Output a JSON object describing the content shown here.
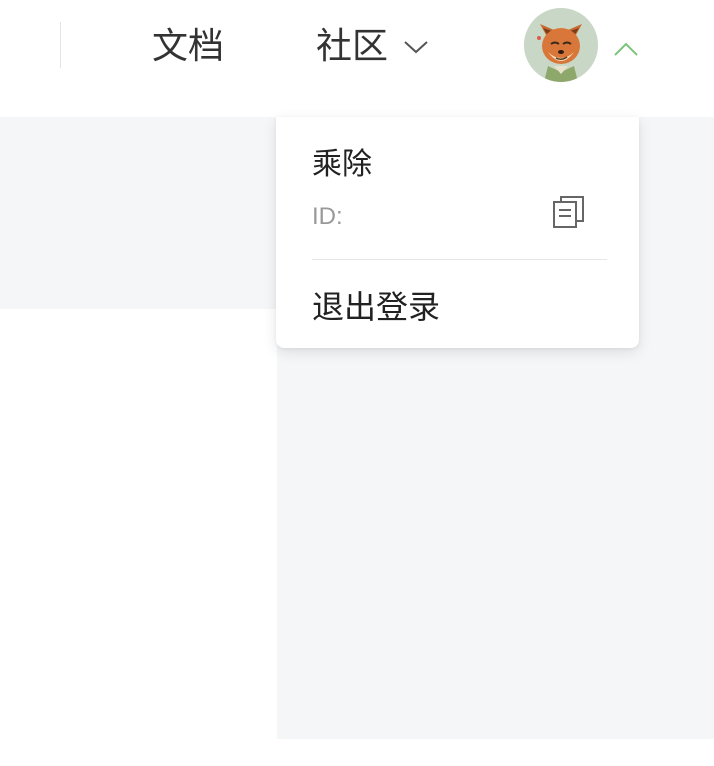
{
  "header": {
    "nav_docs": "文档",
    "nav_community": "社区",
    "avatar_icon": "fox-avatar-icon",
    "chevron_down_icon": "chevron-down-icon",
    "chevron_up_icon": "chevron-up-icon"
  },
  "user_menu": {
    "username": "乘除",
    "id_label": "ID:",
    "copy_icon": "copy-icon",
    "logout_label": "退出登录"
  },
  "colors": {
    "text_primary": "#222222",
    "text_muted": "#999999",
    "accent_green": "#7cc47c",
    "panel_bg": "#f5f6f8"
  }
}
